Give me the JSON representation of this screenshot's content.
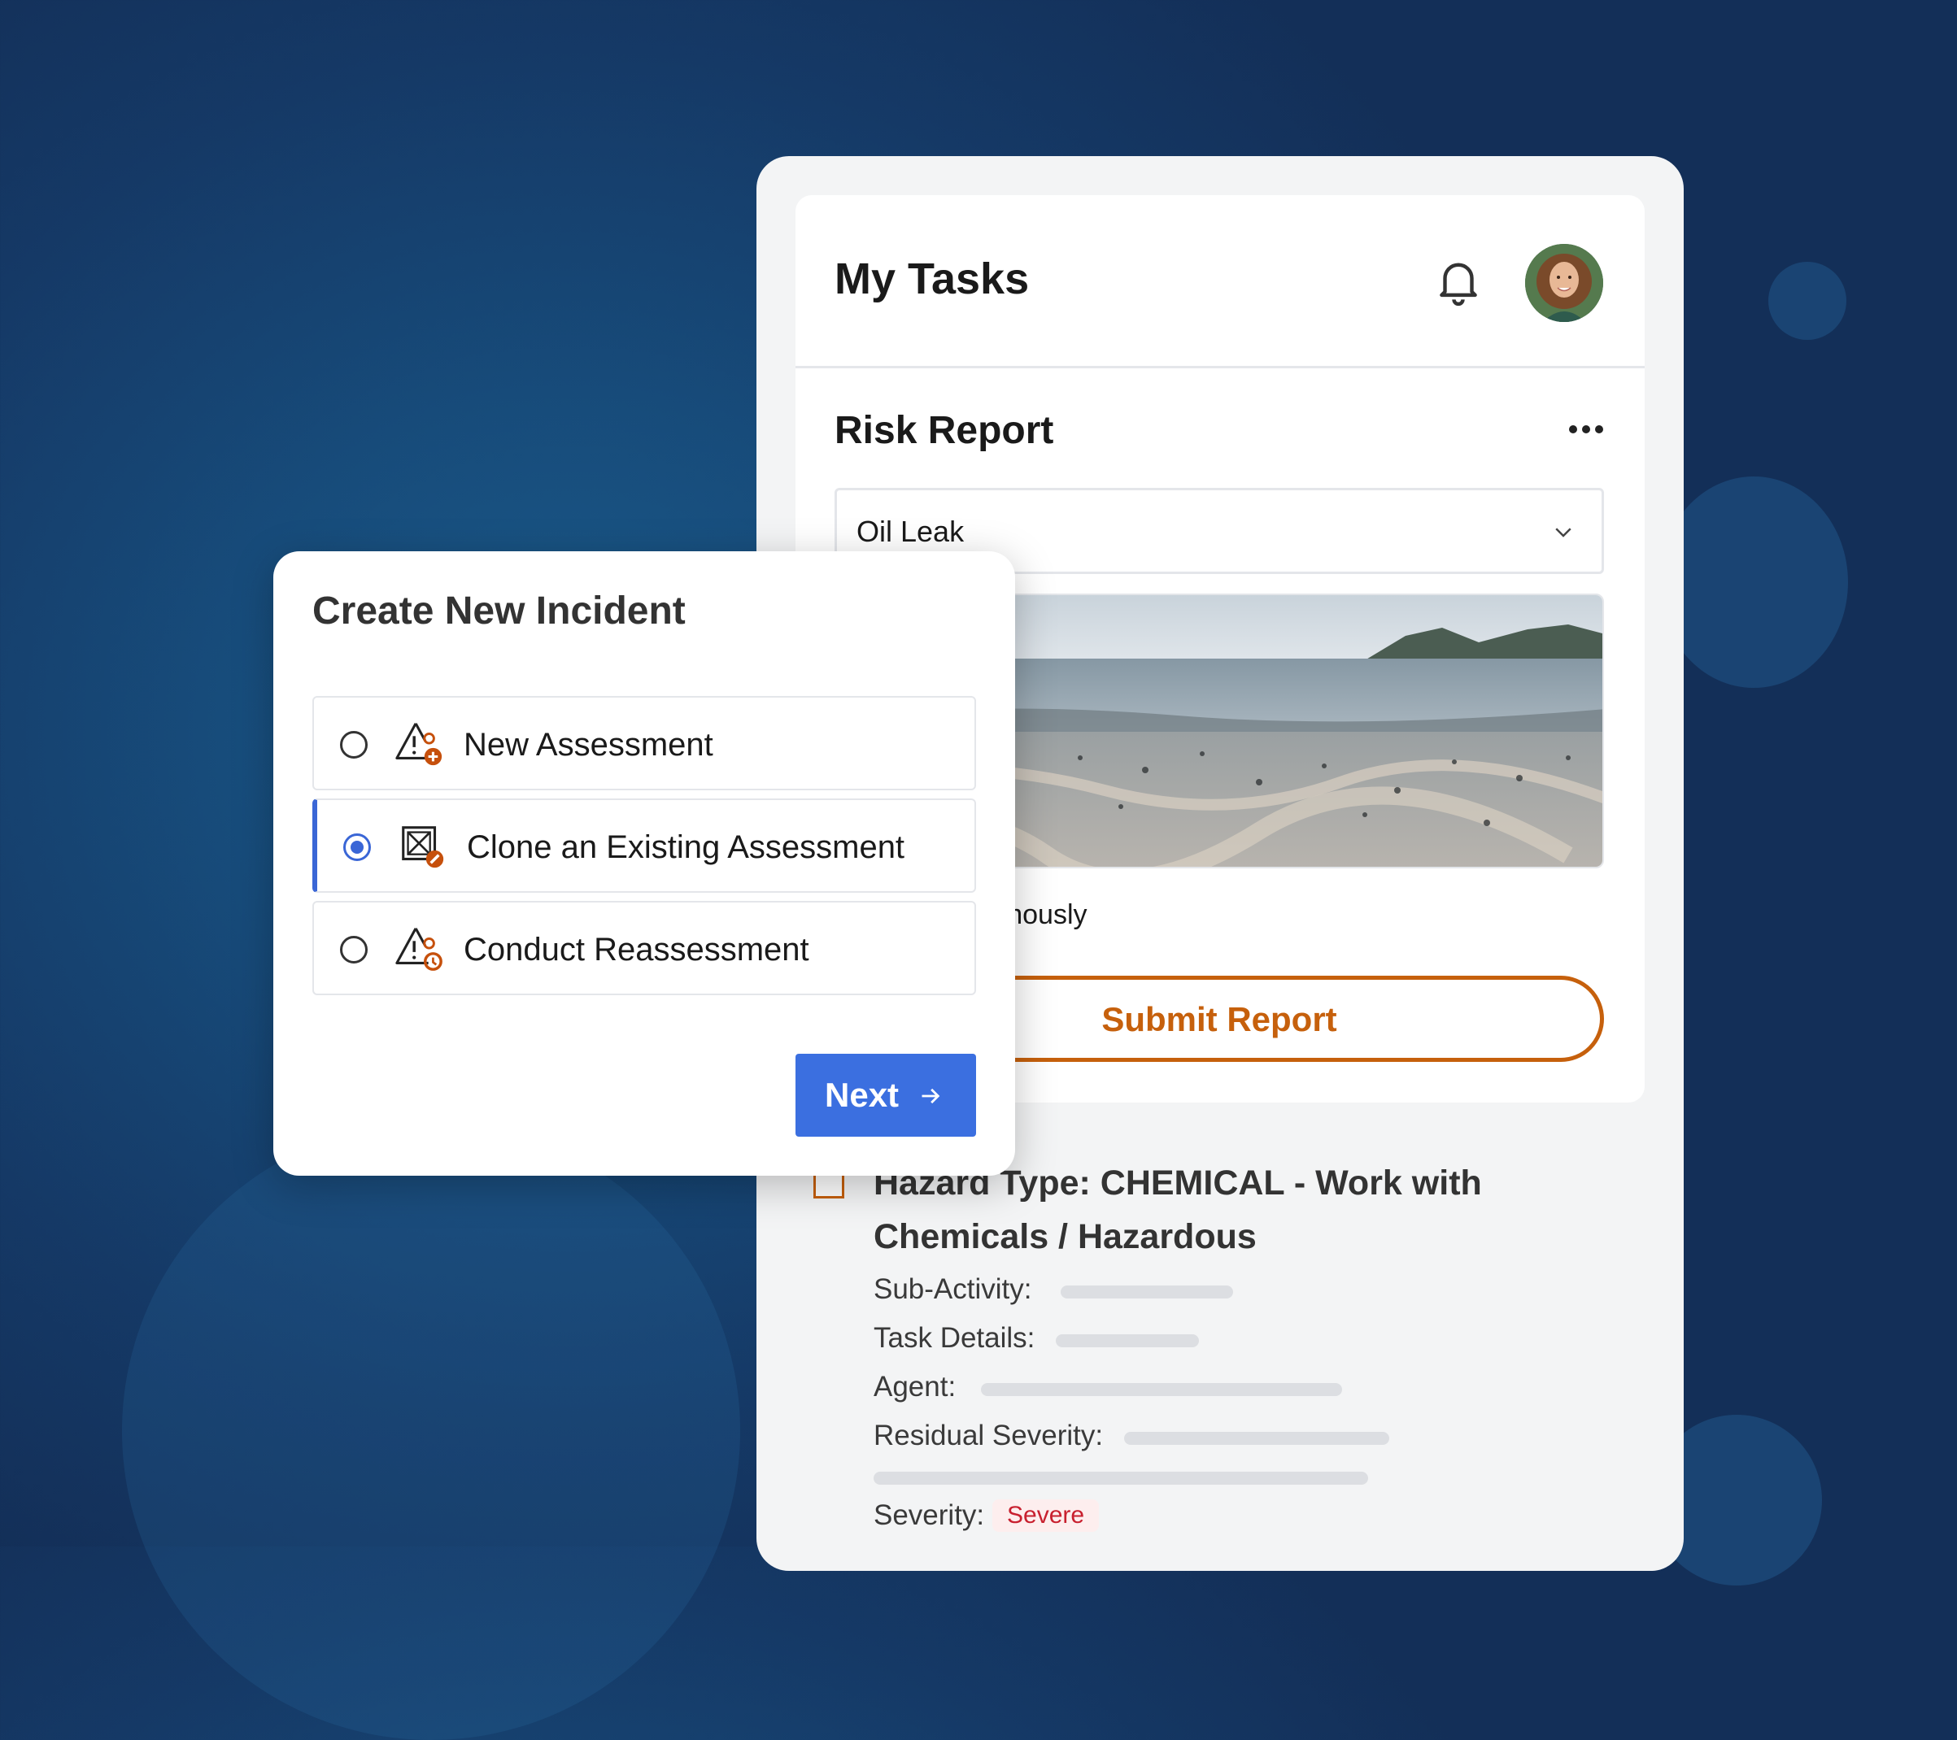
{
  "tasks": {
    "title": "My Tasks",
    "report_title": "Risk Report",
    "incident_select": {
      "value": "Oil Leak"
    },
    "anonymous_label": "onymously",
    "submit_label": "Submit Report",
    "hazard": {
      "title": "Hazard Type: CHEMICAL - Work with Chemicals / Hazardous",
      "fields": {
        "sub_activity": "Sub-Activity:",
        "task_details": "Task Details:",
        "agent": "Agent:",
        "residual_severity": "Residual Severity:",
        "severity": "Severity:"
      },
      "severity_value": "Severe"
    },
    "icons": [
      "bell-icon",
      "avatar",
      "more-icon",
      "chevron-down-icon"
    ]
  },
  "modal": {
    "title": "Create New Incident",
    "options": [
      {
        "label": "New Assessment",
        "icon": "warning-add-icon",
        "selected": false
      },
      {
        "label": "Clone an Existing Assessment",
        "icon": "clone-edit-icon",
        "selected": true
      },
      {
        "label": "Conduct Reassessment",
        "icon": "warning-refresh-icon",
        "selected": false
      }
    ],
    "next_label": "Next"
  },
  "colors": {
    "accent_blue": "#3b6fe0",
    "accent_orange": "#c6600c",
    "severe_red": "#c8202f",
    "background_navy": "#153966"
  }
}
